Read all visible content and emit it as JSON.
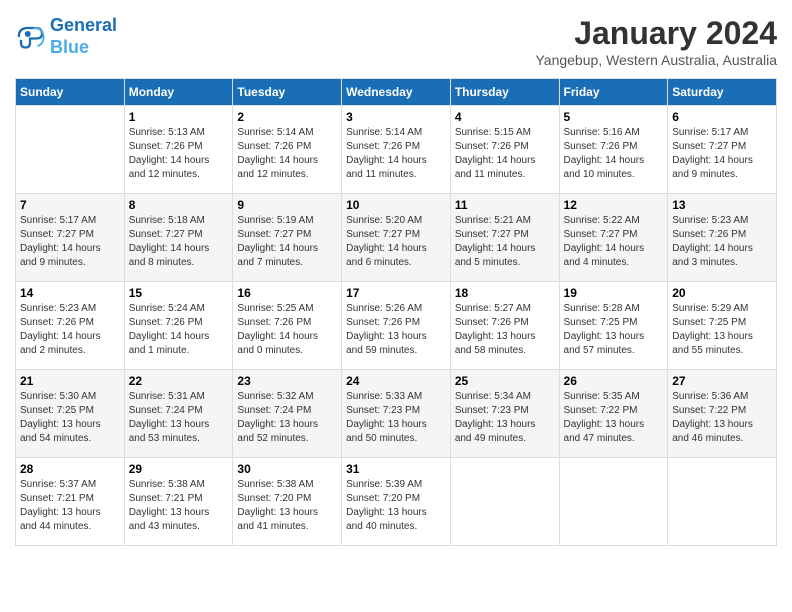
{
  "header": {
    "logo_line1": "General",
    "logo_line2": "Blue",
    "month_title": "January 2024",
    "subtitle": "Yangebup, Western Australia, Australia"
  },
  "weekdays": [
    "Sunday",
    "Monday",
    "Tuesday",
    "Wednesday",
    "Thursday",
    "Friday",
    "Saturday"
  ],
  "weeks": [
    [
      {
        "num": "",
        "info": ""
      },
      {
        "num": "1",
        "info": "Sunrise: 5:13 AM\nSunset: 7:26 PM\nDaylight: 14 hours\nand 12 minutes."
      },
      {
        "num": "2",
        "info": "Sunrise: 5:14 AM\nSunset: 7:26 PM\nDaylight: 14 hours\nand 12 minutes."
      },
      {
        "num": "3",
        "info": "Sunrise: 5:14 AM\nSunset: 7:26 PM\nDaylight: 14 hours\nand 11 minutes."
      },
      {
        "num": "4",
        "info": "Sunrise: 5:15 AM\nSunset: 7:26 PM\nDaylight: 14 hours\nand 11 minutes."
      },
      {
        "num": "5",
        "info": "Sunrise: 5:16 AM\nSunset: 7:26 PM\nDaylight: 14 hours\nand 10 minutes."
      },
      {
        "num": "6",
        "info": "Sunrise: 5:17 AM\nSunset: 7:27 PM\nDaylight: 14 hours\nand 9 minutes."
      }
    ],
    [
      {
        "num": "7",
        "info": "Sunrise: 5:17 AM\nSunset: 7:27 PM\nDaylight: 14 hours\nand 9 minutes."
      },
      {
        "num": "8",
        "info": "Sunrise: 5:18 AM\nSunset: 7:27 PM\nDaylight: 14 hours\nand 8 minutes."
      },
      {
        "num": "9",
        "info": "Sunrise: 5:19 AM\nSunset: 7:27 PM\nDaylight: 14 hours\nand 7 minutes."
      },
      {
        "num": "10",
        "info": "Sunrise: 5:20 AM\nSunset: 7:27 PM\nDaylight: 14 hours\nand 6 minutes."
      },
      {
        "num": "11",
        "info": "Sunrise: 5:21 AM\nSunset: 7:27 PM\nDaylight: 14 hours\nand 5 minutes."
      },
      {
        "num": "12",
        "info": "Sunrise: 5:22 AM\nSunset: 7:27 PM\nDaylight: 14 hours\nand 4 minutes."
      },
      {
        "num": "13",
        "info": "Sunrise: 5:23 AM\nSunset: 7:26 PM\nDaylight: 14 hours\nand 3 minutes."
      }
    ],
    [
      {
        "num": "14",
        "info": "Sunrise: 5:23 AM\nSunset: 7:26 PM\nDaylight: 14 hours\nand 2 minutes."
      },
      {
        "num": "15",
        "info": "Sunrise: 5:24 AM\nSunset: 7:26 PM\nDaylight: 14 hours\nand 1 minute."
      },
      {
        "num": "16",
        "info": "Sunrise: 5:25 AM\nSunset: 7:26 PM\nDaylight: 14 hours\nand 0 minutes."
      },
      {
        "num": "17",
        "info": "Sunrise: 5:26 AM\nSunset: 7:26 PM\nDaylight: 13 hours\nand 59 minutes."
      },
      {
        "num": "18",
        "info": "Sunrise: 5:27 AM\nSunset: 7:26 PM\nDaylight: 13 hours\nand 58 minutes."
      },
      {
        "num": "19",
        "info": "Sunrise: 5:28 AM\nSunset: 7:25 PM\nDaylight: 13 hours\nand 57 minutes."
      },
      {
        "num": "20",
        "info": "Sunrise: 5:29 AM\nSunset: 7:25 PM\nDaylight: 13 hours\nand 55 minutes."
      }
    ],
    [
      {
        "num": "21",
        "info": "Sunrise: 5:30 AM\nSunset: 7:25 PM\nDaylight: 13 hours\nand 54 minutes."
      },
      {
        "num": "22",
        "info": "Sunrise: 5:31 AM\nSunset: 7:24 PM\nDaylight: 13 hours\nand 53 minutes."
      },
      {
        "num": "23",
        "info": "Sunrise: 5:32 AM\nSunset: 7:24 PM\nDaylight: 13 hours\nand 52 minutes."
      },
      {
        "num": "24",
        "info": "Sunrise: 5:33 AM\nSunset: 7:23 PM\nDaylight: 13 hours\nand 50 minutes."
      },
      {
        "num": "25",
        "info": "Sunrise: 5:34 AM\nSunset: 7:23 PM\nDaylight: 13 hours\nand 49 minutes."
      },
      {
        "num": "26",
        "info": "Sunrise: 5:35 AM\nSunset: 7:22 PM\nDaylight: 13 hours\nand 47 minutes."
      },
      {
        "num": "27",
        "info": "Sunrise: 5:36 AM\nSunset: 7:22 PM\nDaylight: 13 hours\nand 46 minutes."
      }
    ],
    [
      {
        "num": "28",
        "info": "Sunrise: 5:37 AM\nSunset: 7:21 PM\nDaylight: 13 hours\nand 44 minutes."
      },
      {
        "num": "29",
        "info": "Sunrise: 5:38 AM\nSunset: 7:21 PM\nDaylight: 13 hours\nand 43 minutes."
      },
      {
        "num": "30",
        "info": "Sunrise: 5:38 AM\nSunset: 7:20 PM\nDaylight: 13 hours\nand 41 minutes."
      },
      {
        "num": "31",
        "info": "Sunrise: 5:39 AM\nSunset: 7:20 PM\nDaylight: 13 hours\nand 40 minutes."
      },
      {
        "num": "",
        "info": ""
      },
      {
        "num": "",
        "info": ""
      },
      {
        "num": "",
        "info": ""
      }
    ]
  ]
}
